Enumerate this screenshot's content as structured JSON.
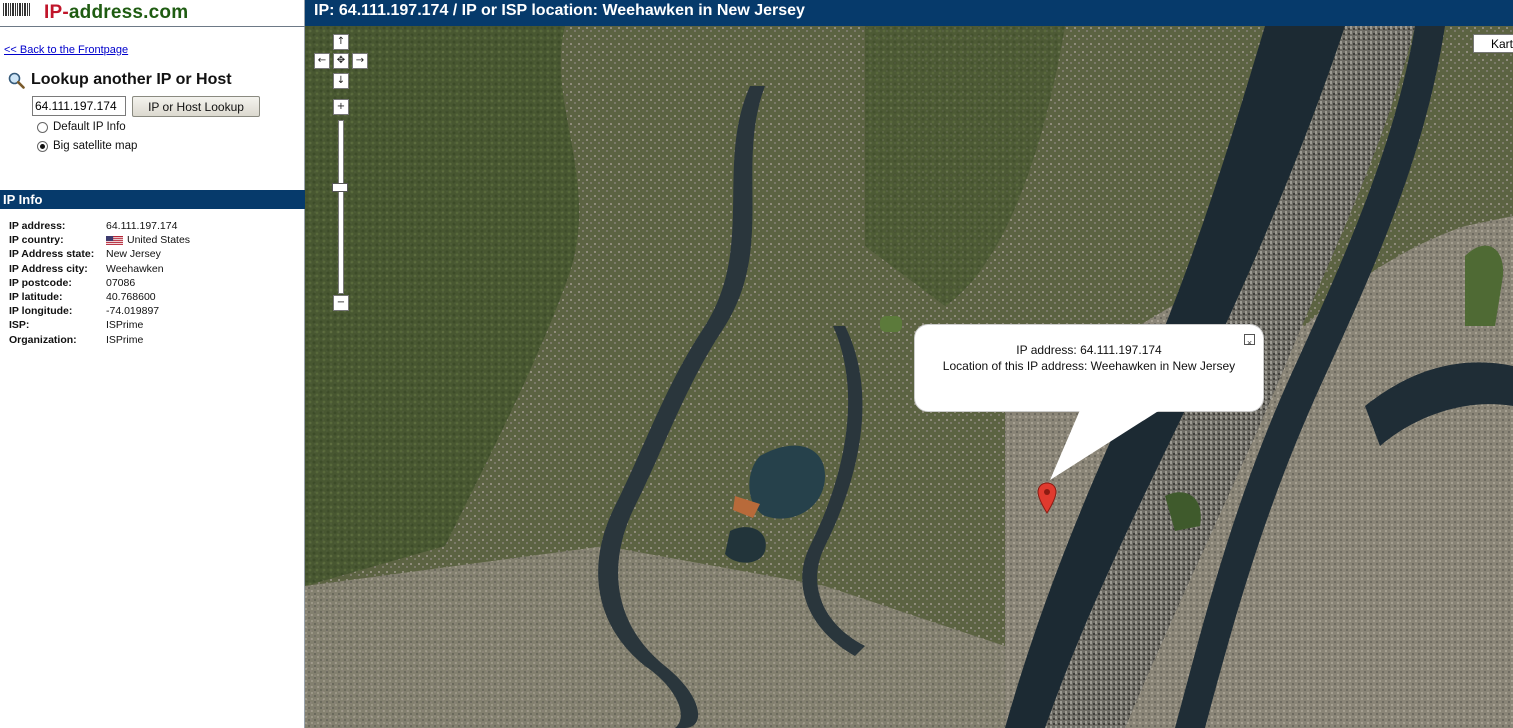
{
  "logo": {
    "ip": "IP",
    "dash": "-",
    "rest": "address.com"
  },
  "nav": {
    "back_link": "<< Back to the Frontpage"
  },
  "lookup": {
    "title": "Lookup another IP or Host",
    "input_value": "64.111.197.174",
    "button_label": "IP or Host Lookup",
    "options": [
      {
        "label": "Default IP Info",
        "selected": false
      },
      {
        "label": "Big satellite map",
        "selected": true
      }
    ]
  },
  "ip_info": {
    "header": "IP Info",
    "rows": [
      {
        "key": "IP address:",
        "value": "64.111.197.174"
      },
      {
        "key": "IP country:",
        "value": "United States",
        "icon": "us-flag-icon"
      },
      {
        "key": "IP Address state:",
        "value": "New Jersey"
      },
      {
        "key": "IP Address city:",
        "value": "Weehawken"
      },
      {
        "key": "IP postcode:",
        "value": "07086"
      },
      {
        "key": "IP latitude:",
        "value": "40.768600"
      },
      {
        "key": "IP longitude:",
        "value": "-74.019897"
      },
      {
        "key": "ISP:",
        "value": "ISPrime"
      },
      {
        "key": "Organization:",
        "value": "ISPrime"
      }
    ]
  },
  "map": {
    "title": "IP: 64.111.197.174 / IP or ISP location: Weehawken in New Jersey",
    "type_button": "Kart",
    "pan": {
      "up": "↑",
      "left": "←",
      "center": "✥",
      "right": "→",
      "down": "↓"
    },
    "zoom_in": "+",
    "zoom_out": "−",
    "balloon": {
      "line1": "IP address: 64.111.197.174",
      "line2": "Location of this IP address: Weehawken in New Jersey",
      "close": "×"
    },
    "icons": [
      "magnifier-icon",
      "map-marker-icon",
      "barcode-icon",
      "close-icon"
    ],
    "colors": {
      "header_bg": "#063a6b",
      "marker": "#e03a2e",
      "link": "#0000cc"
    }
  }
}
